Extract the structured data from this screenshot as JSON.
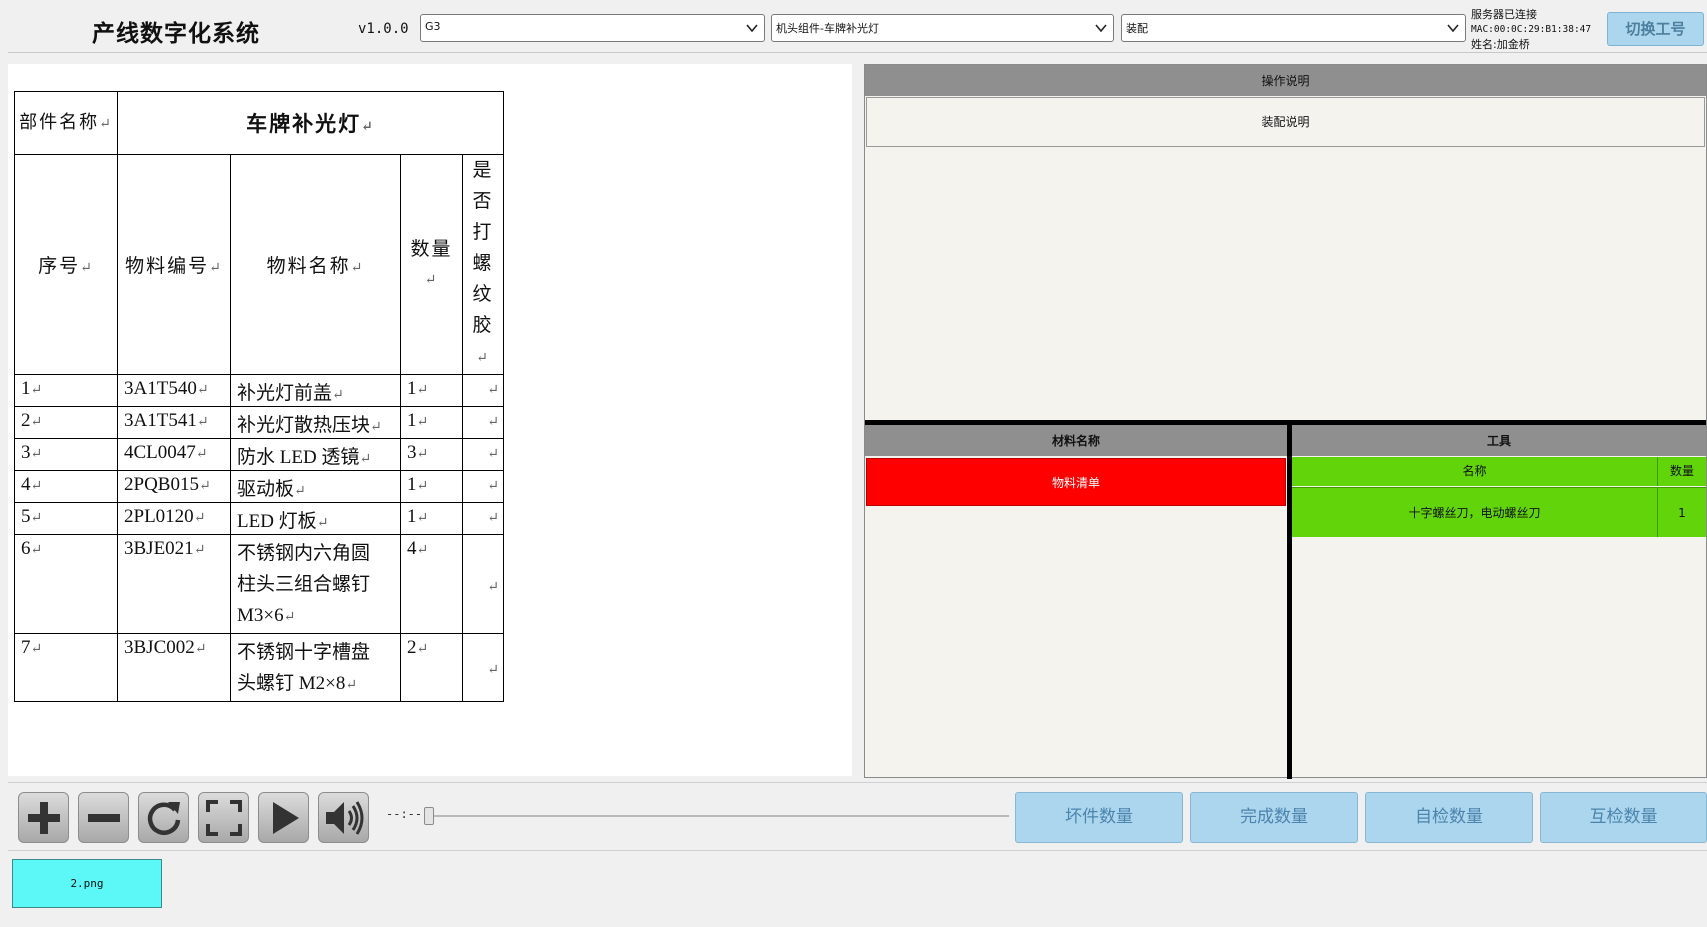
{
  "header": {
    "title": "产线数字化系统",
    "version": "v1.0.0",
    "line_select": "G3",
    "part_select": "机头组件-车牌补光灯",
    "process_select": "装配",
    "status_connected": "服务器已连接",
    "status_mac": "MAC:00:0C:29:B1:38:47",
    "status_name": "姓名:加金桥",
    "switch_button": "切换工号"
  },
  "document": {
    "return_mark": "↵",
    "part_name_label": "部件名称",
    "part_name_value": "车牌补光灯",
    "columns": [
      "序号",
      "物料编号",
      "物料名称",
      "数量",
      "是否打螺纹胶"
    ],
    "rows": [
      {
        "no": "1",
        "code": "3A1T540",
        "name": "补光灯前盖",
        "qty": "1"
      },
      {
        "no": "2",
        "code": "3A1T541",
        "name": "补光灯散热压块",
        "qty": "1"
      },
      {
        "no": "3",
        "code": "4CL0047",
        "name": "防水 LED 透镜",
        "qty": "3"
      },
      {
        "no": "4",
        "code": "2PQB015",
        "name": "驱动板",
        "qty": "1"
      },
      {
        "no": "5",
        "code": "2PL0120",
        "name": "LED 灯板",
        "qty": "1"
      },
      {
        "no": "6",
        "code": "3BJE021",
        "name_lines": [
          "不锈钢内六角圆",
          "柱头三组合螺钉",
          "M3×6"
        ],
        "qty": "4"
      },
      {
        "no": "7",
        "code": "3BJC002",
        "name_lines": [
          "不锈钢十字槽盘",
          "头螺钉 M2×8"
        ],
        "qty": "2"
      }
    ]
  },
  "right_panel": {
    "operation_header": "操作说明",
    "operation_text": "装配说明",
    "material_header": "材料名称",
    "material_item": "物料清单",
    "tool_header": "工具",
    "tool_col_name": "名称",
    "tool_col_qty": "数量",
    "tool_name": "十字螺丝刀，电动螺丝刀",
    "tool_qty": "1"
  },
  "player": {
    "time": "--:--",
    "position": 0
  },
  "stats": {
    "bad_count": "坏件数量",
    "done_count": "完成数量",
    "self_check": "自检数量",
    "mutual_check": "互检数量"
  },
  "thumbnails": [
    "2.png"
  ],
  "colors": {
    "material_bg": "#ff0000",
    "tool_bg": "#62d40a",
    "button_bg": "#acd6ee",
    "thumb_bg": "#5cf8f8"
  }
}
